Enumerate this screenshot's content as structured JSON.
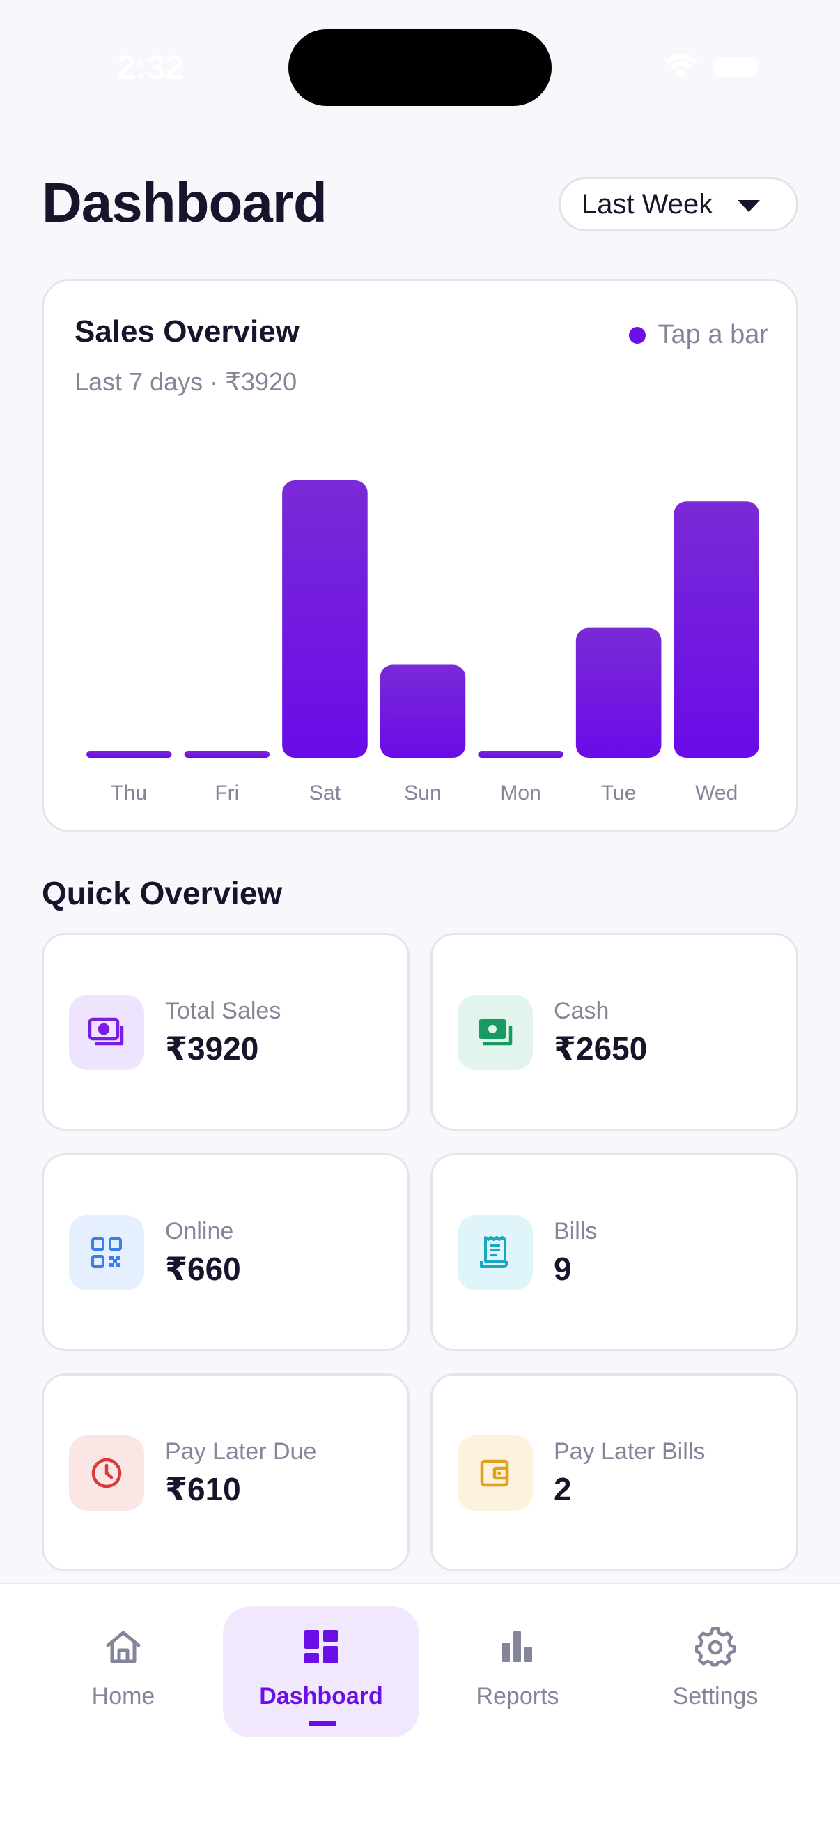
{
  "status_bar": {
    "time": "2:32"
  },
  "header": {
    "title": "Dashboard",
    "range_select": {
      "value": "Last Week",
      "icon": "chevron-down-icon"
    }
  },
  "sales_overview": {
    "title": "Sales Overview",
    "subtitle": "Last 7 days · ₹3920",
    "hint": "Tap a bar",
    "accent": "#6b0fe6"
  },
  "chart_data": {
    "type": "bar",
    "title": "Sales Overview",
    "subtitle": "Last 7 days · ₹3920",
    "categories": [
      "Thu",
      "Fri",
      "Sat",
      "Sun",
      "Mon",
      "Tue",
      "Wed"
    ],
    "values": [
      0,
      0,
      1580,
      530,
      0,
      740,
      1460
    ],
    "xlabel": "",
    "ylabel": "",
    "ylim": [
      0,
      1580
    ],
    "grid": false,
    "bar_color_top": "#7a2ad6",
    "bar_color_bottom": "#6a0be8"
  },
  "quick_overview": {
    "title": "Quick Overview",
    "cards": [
      {
        "label": "Total Sales",
        "value": "₹3920",
        "icon": "cash-icon",
        "icon_color": "#7a1ee6",
        "bg": "#efe4fd"
      },
      {
        "label": "Cash",
        "value": "₹2650",
        "icon": "banknote-icon",
        "icon_color": "#1a9a63",
        "bg": "#e2f5ec"
      },
      {
        "label": "Online",
        "value": "₹660",
        "icon": "qr-code-icon",
        "icon_color": "#3b7ef0",
        "bg": "#e6effd"
      },
      {
        "label": "Bills",
        "value": "9",
        "icon": "receipt-icon",
        "icon_color": "#1aa7c2",
        "bg": "#e0f5f9"
      },
      {
        "label": "Pay Later Due",
        "value": "₹610",
        "icon": "clock-icon",
        "icon_color": "#d93a3a",
        "bg": "#fbe6e6"
      },
      {
        "label": "Pay Later Bills",
        "value": "2",
        "icon": "wallet-icon",
        "icon_color": "#e0a21a",
        "bg": "#fcf2dd"
      }
    ]
  },
  "bottom_nav": {
    "items": [
      {
        "label": "Home",
        "icon": "home-icon",
        "active": false
      },
      {
        "label": "Dashboard",
        "icon": "dashboard-icon",
        "active": true
      },
      {
        "label": "Reports",
        "icon": "bar-chart-icon",
        "active": false
      },
      {
        "label": "Settings",
        "icon": "gear-icon",
        "active": false
      }
    ]
  }
}
